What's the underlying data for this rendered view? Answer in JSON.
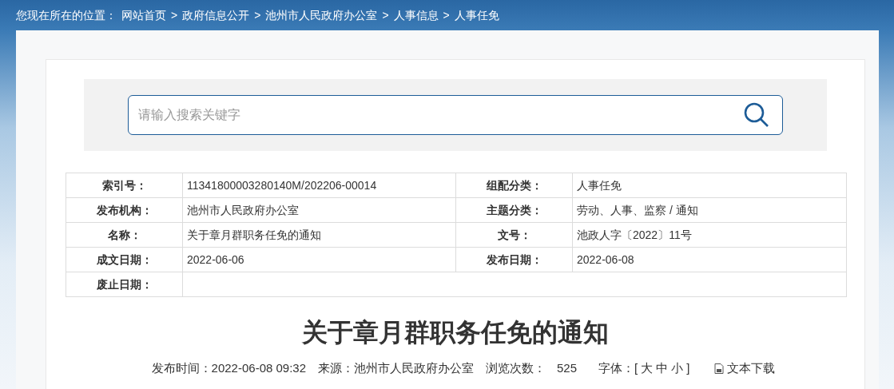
{
  "breadcrumb": {
    "label": "您现在所在的位置：",
    "separator": ">",
    "items": [
      "网站首页",
      "政府信息公开",
      "池州市人民政府办公室",
      "人事信息",
      "人事任免"
    ]
  },
  "search": {
    "placeholder": "请输入搜索关键字"
  },
  "info_table": {
    "rows": [
      [
        {
          "label": "索引号：",
          "value": "11341800003280140M/202206-00014"
        },
        {
          "label": "组配分类：",
          "value": "人事任免"
        }
      ],
      [
        {
          "label": "发布机构：",
          "value": "池州市人民政府办公室"
        },
        {
          "label": "主题分类：",
          "value": "劳动、人事、监察 / 通知"
        }
      ],
      [
        {
          "label": "名称：",
          "value": "关于章月群职务任免的通知"
        },
        {
          "label": "文号：",
          "value": "池政人字〔2022〕11号"
        }
      ],
      [
        {
          "label": "成文日期：",
          "value": "2022-06-06"
        },
        {
          "label": "发布日期：",
          "value": "2022-06-08"
        }
      ],
      [
        {
          "label": "废止日期："
        }
      ]
    ]
  },
  "article": {
    "title": "关于章月群职务任免的通知",
    "publish_time": "发布时间：2022-06-08 09:32",
    "source": "来源：池州市人民政府办公室",
    "views_label": "浏览次数：",
    "views": "525",
    "font_size": {
      "label": "字体：[",
      "options": [
        "大",
        "中",
        "小"
      ],
      "suffix": "]"
    },
    "download": "文本下载"
  }
}
